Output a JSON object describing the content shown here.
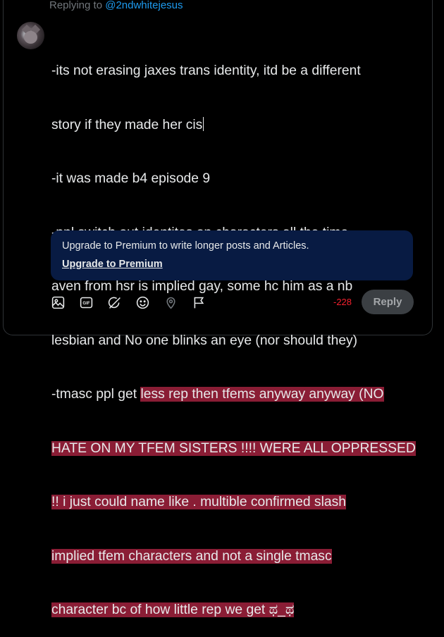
{
  "header": {
    "replying_prefix": "Replying to ",
    "replying_handle": "@2ndwhitejesus"
  },
  "post": {
    "lines": [
      "-its not erasing jaxes trans identity, itd be a different",
      "story if they made her cis",
      "-it was made b4 episode 9",
      "-ppl switch out identites on characters all the time.",
      "aven from hsr is implied gay, some hc him as a nb",
      "lesbian and No one blinks an eye (nor should they)",
      "-tmasc ppl get ",
      "less rep then tfems anyway anyway (NO",
      "HATE ON MY TFEM SISTERS !!!! WERE ALL OPPRESSED",
      "!! i just could name like . multible confirmed slash",
      "implied tfem characters and not a single tmasc",
      "character bc of how little rep we get ಥ_ಥ"
    ]
  },
  "upsell": {
    "message": "Upgrade to Premium to write longer posts and Articles.",
    "link": "Upgrade to Premium"
  },
  "toolbar": {
    "icons": [
      "image-icon",
      "gif-icon",
      "grok-icon",
      "emoji-icon",
      "location-icon",
      "flag-icon"
    ]
  },
  "char_count": "-228",
  "reply_button": "Reply",
  "colors": {
    "accent": "#1d9bf0",
    "error": "#f4212e",
    "highlight": "#8a1d35",
    "upsell_bg": "#081b43"
  }
}
